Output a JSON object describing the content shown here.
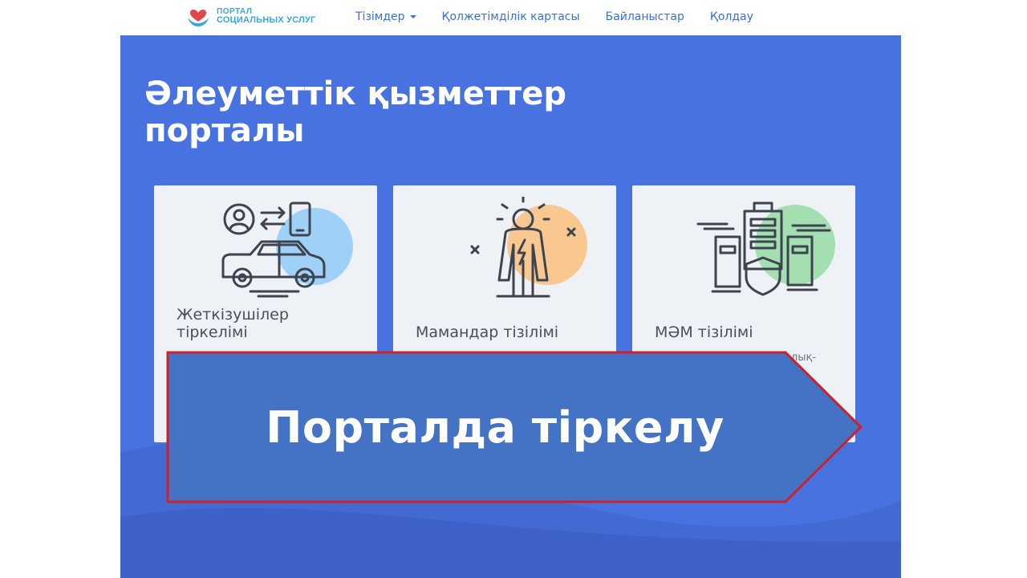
{
  "header": {
    "logo": {
      "line1": "ПОРТАЛ",
      "line2": "СОЦИАЛЬНЫХ УСЛУГ",
      "icon": "heart-hands-icon"
    },
    "nav": [
      {
        "label": "Тізімдер",
        "has_dropdown": true
      },
      {
        "label": "Қолжетімділік картасы"
      },
      {
        "label": "Байланыстар"
      },
      {
        "label": "Қолдау"
      }
    ]
  },
  "hero": {
    "title": "Әлеуметтік қызметтер порталы",
    "cards": [
      {
        "title": "Жеткізушілер тіркелімі",
        "icon": "car-user-phone-icon",
        "accent": "#9fd1f8"
      },
      {
        "title": "Мамандар тізілімі",
        "icon": "hero-specialist-icon",
        "accent": "#f8c890",
        "desc": ""
      },
      {
        "title": "МӘМ тізілімі",
        "icon": "buildings-shield-icon",
        "accent": "#a4dfb2",
        "desc": "алық-"
      }
    ]
  },
  "banner": {
    "text": "Порталда тіркелу",
    "fill": "#4472c4",
    "border": "#d0202a"
  },
  "colors": {
    "hero_bg": "#4872e0",
    "nav_link": "#3a6fd8",
    "logo_text": "#3aa7dd"
  }
}
